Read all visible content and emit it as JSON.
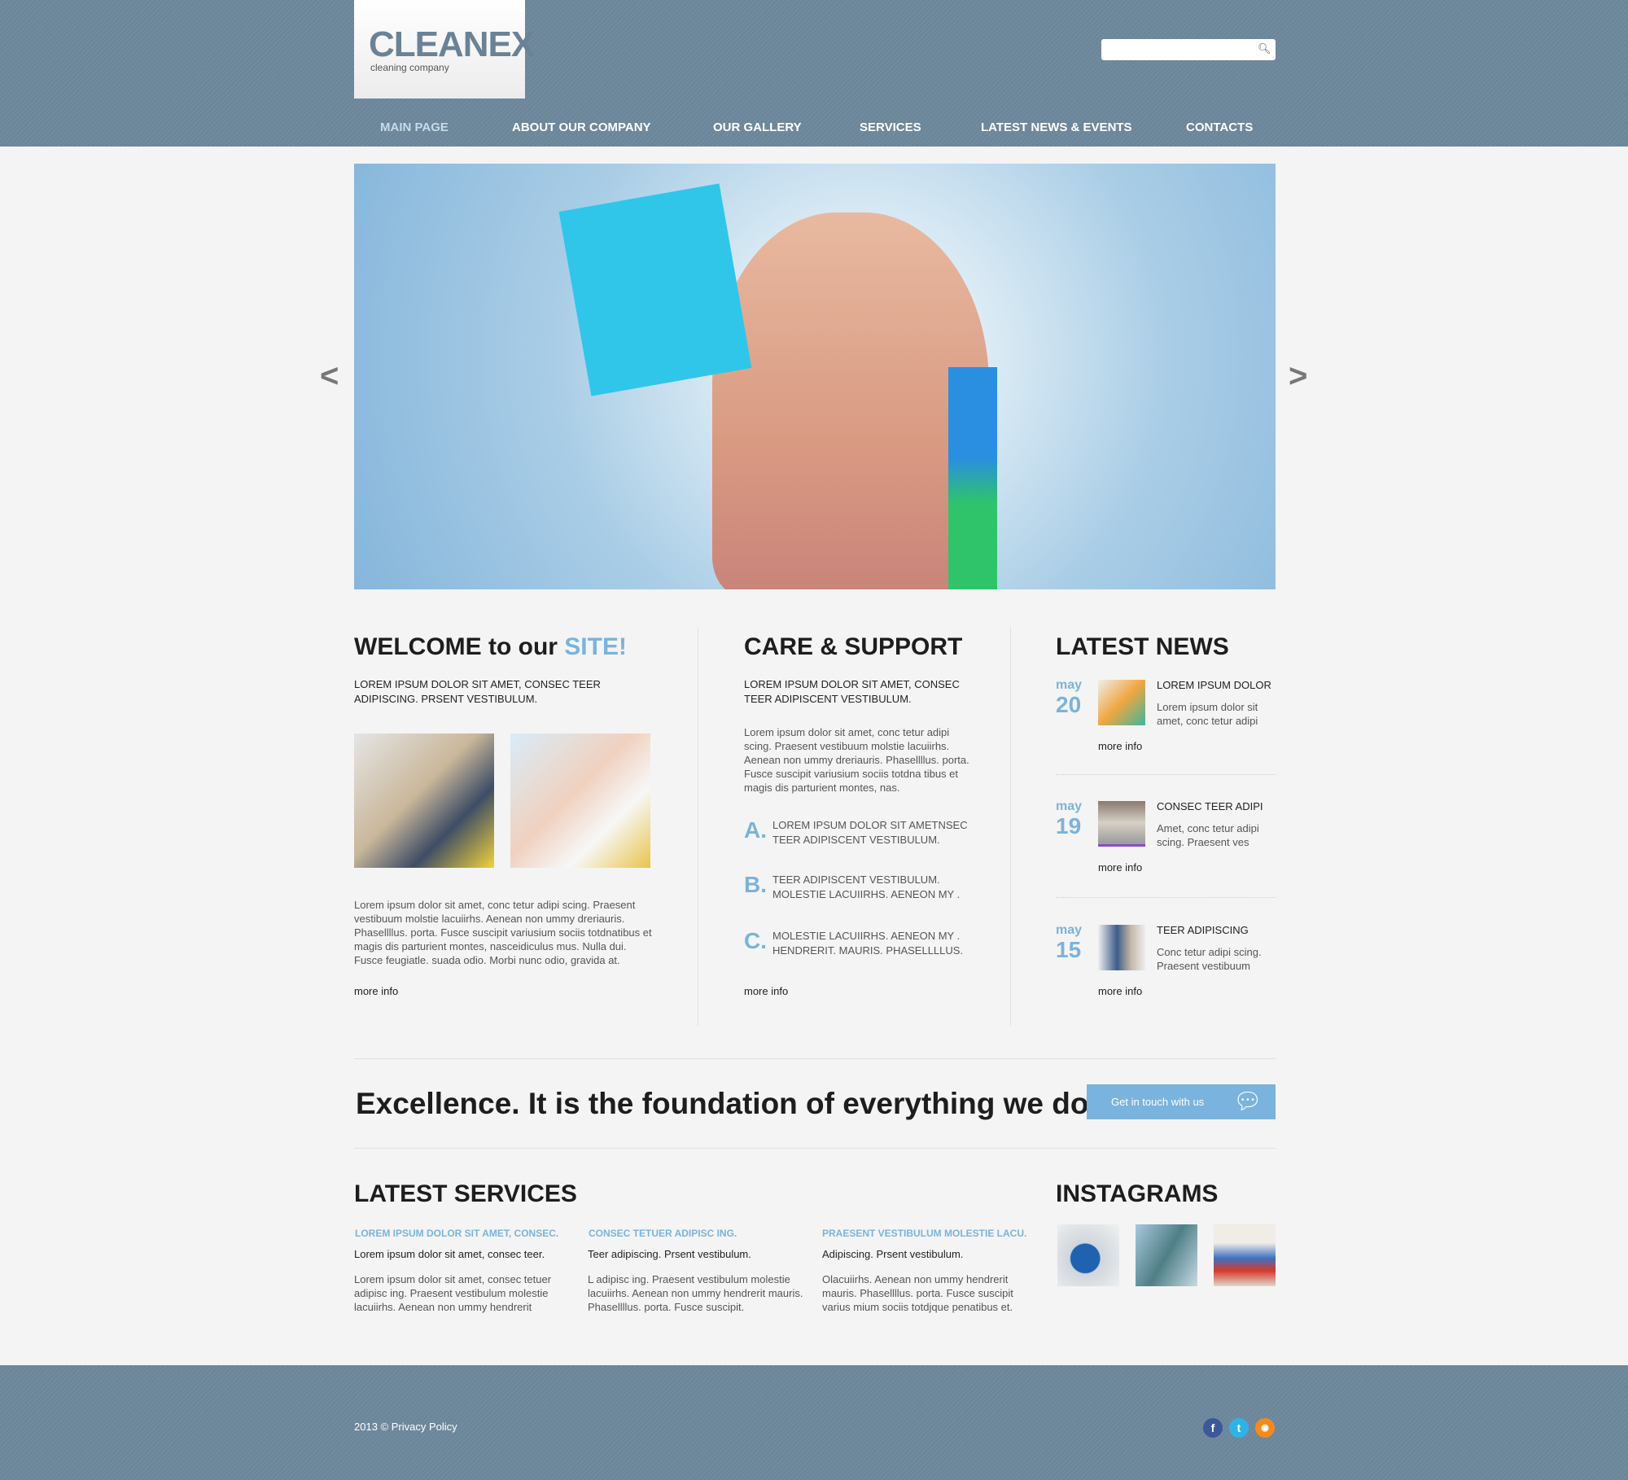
{
  "header": {
    "logo_title": "CLEANEX",
    "logo_subtitle": "cleaning company",
    "search_placeholder": "",
    "search_icon": "magnifier-icon"
  },
  "nav": [
    {
      "label": "MAIN PAGE",
      "active": true
    },
    {
      "label": "ABOUT OUR COMPANY"
    },
    {
      "label": "OUR GALLERY"
    },
    {
      "label": "SERVICES"
    },
    {
      "label": "LATEST NEWS & EVENTS"
    },
    {
      "label": "CONTACTS"
    }
  ],
  "slider": {
    "prev": "<",
    "next": ">"
  },
  "welcome": {
    "title_a": "WELCOME to our ",
    "title_b": "SITE!",
    "caps": "LOREM IPSUM DOLOR SIT AMET, CONSEC TEER ADIPISCING. PRSENT VESTIBULUM.",
    "body": "Lorem ipsum dolor sit amet, conc tetur adipi scing. Praesent vestibuum molstie lacuiirhs. Aenean non ummy dreriauris. Phasellllus. porta. Fusce suscipit variusium sociis totdnatibus et magis dis parturient montes, nasceidiculus mus. Nulla dui. Fusce feugiatle. suada odio. Morbi nunc odio, gravida at.",
    "more": "more info"
  },
  "care": {
    "title": "CARE & SUPPORT",
    "caps": "LOREM IPSUM DOLOR SIT AMET, CONSEC TEER ADIPISCENT VESTIBULUM.",
    "body": "Lorem ipsum dolor sit amet, conc tetur adipi scing. Praesent vestibuum molstie lacuiirhs. Aenean non ummy dreriauris. Phasellllus. porta. Fusce suscipit variusium sociis totdna tibus et magis dis parturient montes, nas.",
    "items": [
      {
        "letter": "A.",
        "text": "LOREM IPSUM DOLOR SIT AMETNSEC TEER ADIPISCENT VESTIBULUM."
      },
      {
        "letter": "B.",
        "text": "TEER ADIPISCENT VESTIBULUM. MOLESTIE LACUIIRHS. AENEON MY ."
      },
      {
        "letter": "C.",
        "text": "MOLESTIE LACUIIRHS. AENEON MY . HENDRERIT. MAURIS. PHASELLLLUS."
      }
    ],
    "more": "more info"
  },
  "news": {
    "title": "LATEST NEWS",
    "items": [
      {
        "month": "may",
        "day": "20",
        "title": "LOREM IPSUM DOLOR",
        "text": "Lorem ipsum dolor sit amet, conc tetur adipi",
        "more": "more info"
      },
      {
        "month": "may",
        "day": "19",
        "title": "CONSEC TEER ADIPI",
        "text": "Amet, conc tetur adipi scing. Praesent ves",
        "more": "more info"
      },
      {
        "month": "may",
        "day": "15",
        "title": "TEER ADIPISCING",
        "text": "Conc tetur adipi scing. Praesent vestibuum",
        "more": "more info"
      }
    ]
  },
  "banner": {
    "text": "Excellence. It is the foundation of everything we do.",
    "button": "Get in touch  with us"
  },
  "services": {
    "title": "LATEST SERVICES",
    "items": [
      {
        "title": "LOREM IPSUM DOLOR SIT AMET, CONSEC.",
        "sub": "Lorem ipsum dolor sit amet, consec teer.",
        "text": "Lorem ipsum dolor sit amet, consec tetuer adipisc ing. Praesent vestibulum molestie lacuiirhs. Aenean non ummy hendrerit"
      },
      {
        "title": "CONSEC TETUER ADIPISC ING.",
        "sub": "Teer adipiscing. Prsent vestibulum.",
        "text": "L adipisc ing. Praesent vestibulum molestie lacuiirhs. Aenean non ummy hendrerit mauris. Phasellllus. porta. Fusce suscipit."
      },
      {
        "title": "PRAESENT VESTIBULUM MOLESTIE LACU.",
        "sub": "Adipiscing. Prsent vestibulum.",
        "text": "Olacuiirhs. Aenean non ummy hendrerit mauris. Phasellllus. porta. Fusce suscipit varius mium sociis totdjque penatibus et."
      }
    ]
  },
  "instagrams": {
    "title": "INSTAGRAMS"
  },
  "footer": {
    "copyright": "2013 © Privacy Policy",
    "social": [
      {
        "icon": "facebook-icon",
        "glyph": "f",
        "color": "#3b5998"
      },
      {
        "icon": "twitter-icon",
        "glyph": "t",
        "color": "#2fb3e6"
      },
      {
        "icon": "rss-icon",
        "glyph": "◉",
        "color": "#f28b1b"
      }
    ]
  },
  "colors": {
    "header_bg": "#6a8599",
    "accent": "#7ab3dd",
    "page_bg": "#f4f4f4"
  }
}
